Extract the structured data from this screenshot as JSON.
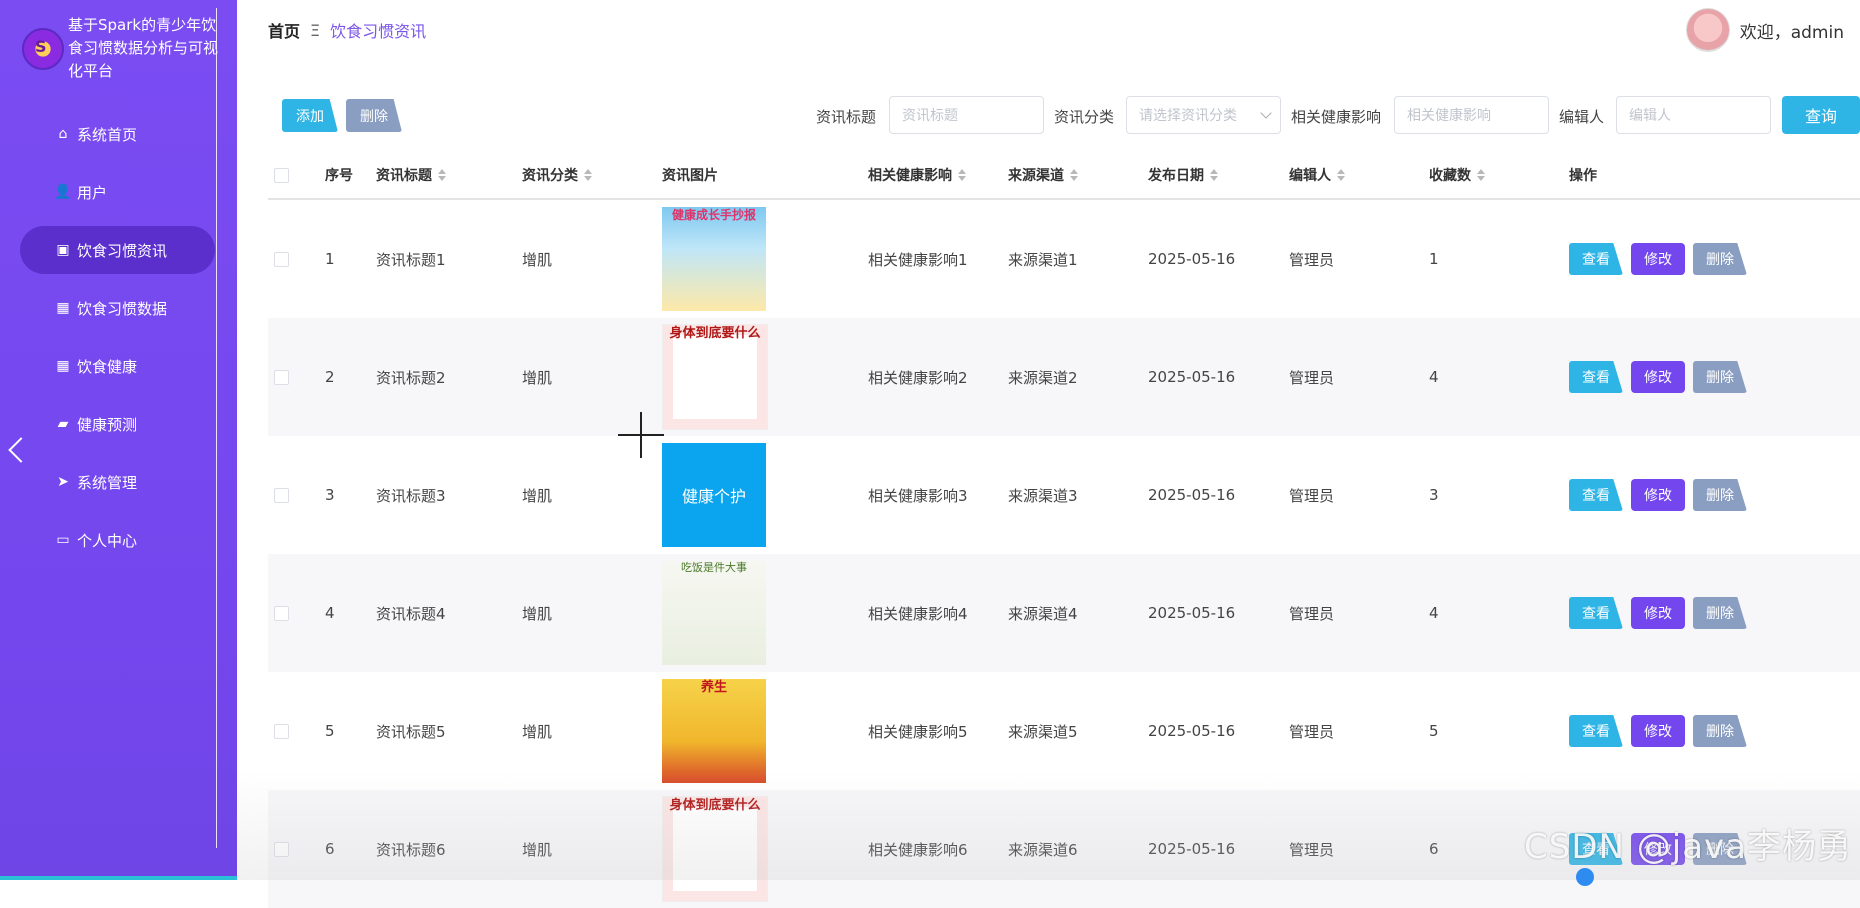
{
  "sidebar": {
    "app_title": "基于Spark的青少年饮食习惯数据分析与可视化平台",
    "items": [
      {
        "label": "系统首页",
        "icon": "home-icon",
        "glyph": "⌂",
        "active": false
      },
      {
        "label": "用户",
        "icon": "user-icon",
        "glyph": "👤",
        "active": false
      },
      {
        "label": "饮食习惯资讯",
        "icon": "clipboard-icon",
        "glyph": "▣",
        "active": true
      },
      {
        "label": "饮食习惯数据",
        "icon": "grid-icon",
        "glyph": "▦",
        "active": false
      },
      {
        "label": "饮食健康",
        "icon": "grid-icon",
        "glyph": "▦",
        "active": false
      },
      {
        "label": "健康预测",
        "icon": "wallet-icon",
        "glyph": "▰",
        "active": false
      },
      {
        "label": "系统管理",
        "icon": "send-icon",
        "glyph": "➤",
        "active": false
      },
      {
        "label": "个人中心",
        "icon": "id-card-icon",
        "glyph": "▭",
        "active": false
      }
    ]
  },
  "header": {
    "breadcrumb_home": "首页",
    "breadcrumb_sep": "Ξ",
    "breadcrumb_current": "饮食习惯资讯",
    "welcome": "欢迎，admin"
  },
  "toolbar": {
    "add_label": "添加",
    "delete_label": "删除",
    "query_label": "查询",
    "filters": {
      "title_label": "资讯标题",
      "title_placeholder": "资讯标题",
      "category_label": "资讯分类",
      "category_placeholder": "请选择资讯分类",
      "impact_label": "相关健康影响",
      "impact_placeholder": "相关健康影响",
      "editor_label": "编辑人",
      "editor_placeholder": "编辑人"
    }
  },
  "table": {
    "headers": {
      "index": "序号",
      "title": "资讯标题",
      "category": "资讯分类",
      "image": "资讯图片",
      "impact": "相关健康影响",
      "source": "来源渠道",
      "date": "发布日期",
      "editor": "编辑人",
      "favorites": "收藏数",
      "actions": "操作"
    },
    "action_labels": {
      "view": "查看",
      "edit": "修改",
      "delete": "删除"
    },
    "rows": [
      {
        "index": "1",
        "title": "资讯标题1",
        "category": "增肌",
        "impact": "相关健康影响1",
        "source": "来源渠道1",
        "date": "2025-05-16",
        "editor": "管理员",
        "favorites": "1",
        "image_text": "健康成长手抄报"
      },
      {
        "index": "2",
        "title": "资讯标题2",
        "category": "增肌",
        "impact": "相关健康影响2",
        "source": "来源渠道2",
        "date": "2025-05-16",
        "editor": "管理员",
        "favorites": "4",
        "image_text": "身体到底要什么"
      },
      {
        "index": "3",
        "title": "资讯标题3",
        "category": "增肌",
        "impact": "相关健康影响3",
        "source": "来源渠道3",
        "date": "2025-05-16",
        "editor": "管理员",
        "favorites": "3",
        "image_text": "健康个护"
      },
      {
        "index": "4",
        "title": "资讯标题4",
        "category": "增肌",
        "impact": "相关健康影响4",
        "source": "来源渠道4",
        "date": "2025-05-16",
        "editor": "管理员",
        "favorites": "4",
        "image_text": "吃饭是件大事"
      },
      {
        "index": "5",
        "title": "资讯标题5",
        "category": "增肌",
        "impact": "相关健康影响5",
        "source": "来源渠道5",
        "date": "2025-05-16",
        "editor": "管理员",
        "favorites": "5",
        "image_text": "养生"
      },
      {
        "index": "6",
        "title": "资讯标题6",
        "category": "增肌",
        "impact": "相关健康影响6",
        "source": "来源渠道6",
        "date": "2025-05-16",
        "editor": "管理员",
        "favorites": "6",
        "image_text": "身体到底要什么"
      }
    ]
  },
  "watermark": "CSDN @java李杨勇",
  "colors": {
    "sidebar": "#7447ee",
    "accent": "#2eb5e6",
    "edit": "#7447ee",
    "neutral": "#8a9ec2"
  }
}
